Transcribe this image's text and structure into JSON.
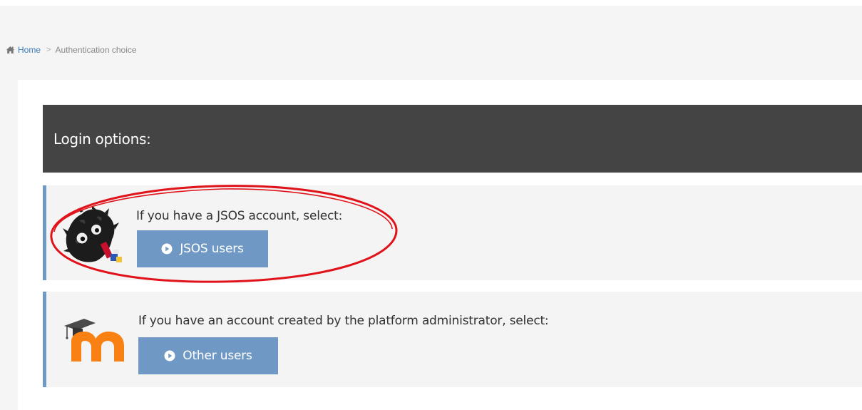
{
  "breadcrumb": {
    "home_label": "Home",
    "separator": ">",
    "current_label": "Authentication choice"
  },
  "login_header": {
    "title": "Login options:"
  },
  "options": {
    "jsos": {
      "prompt": "If you have a JSOS account, select:",
      "button_label": "JSOS users",
      "icon": "mascot-image"
    },
    "other": {
      "prompt": "If you have an account created by the platform administrator, select:",
      "button_label": "Other users",
      "icon": "moodle-logo"
    }
  },
  "colors": {
    "header_bg": "#444444",
    "panel_bg": "#f4f4f4",
    "accent_blue": "#6f99c4",
    "link_blue": "#3a7bb5",
    "moodle_orange": "#f98012",
    "annotation_red": "#e0131b"
  }
}
